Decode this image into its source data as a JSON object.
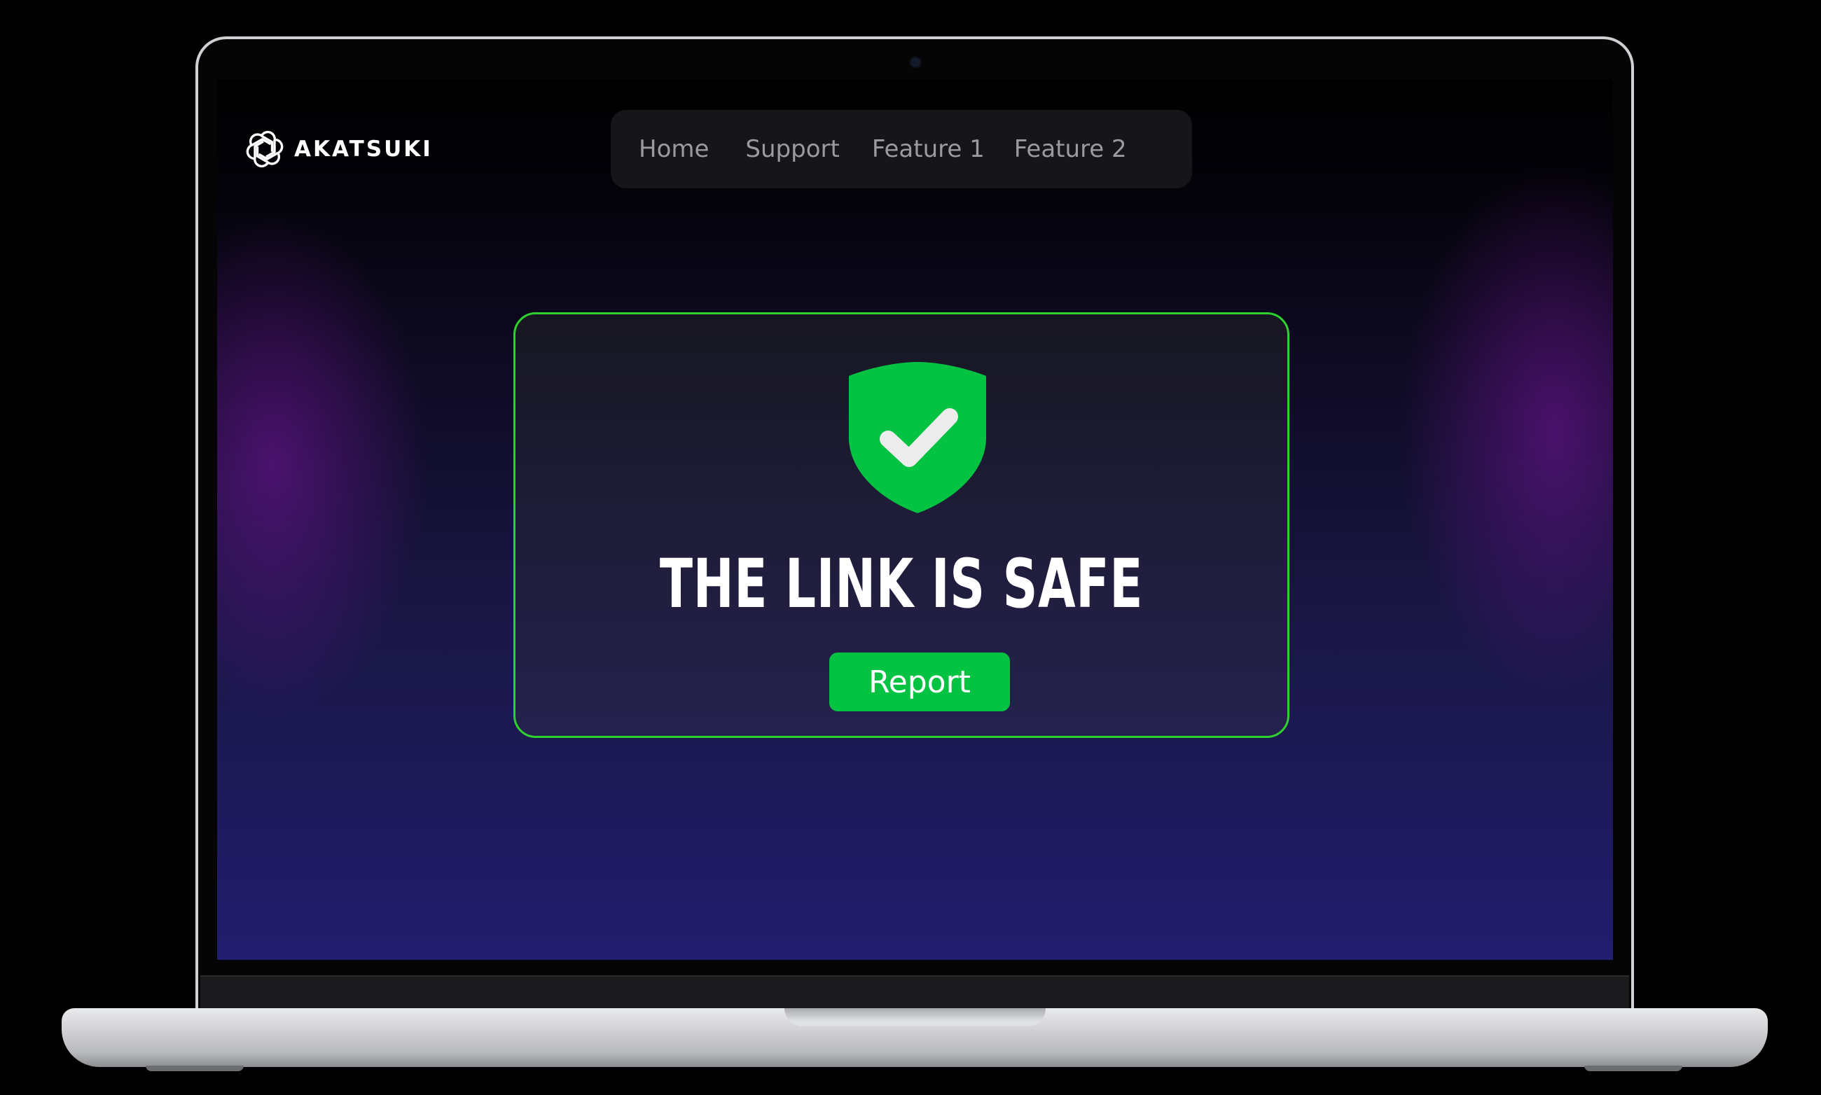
{
  "brand": {
    "name": "AKATSUKI",
    "icon": "openai-knot-logo"
  },
  "nav": {
    "items": [
      {
        "label": "Home"
      },
      {
        "label": "Support"
      },
      {
        "label": "Feature 1"
      },
      {
        "label": "Feature 2"
      }
    ]
  },
  "result": {
    "icon": "shield-check-icon",
    "headline": "THE LINK IS SAFE",
    "button_label": "Report"
  },
  "colors": {
    "accent_green": "#04c343",
    "card_border": "#2ed12e",
    "nav_bg": "#161618",
    "nav_text": "#9a9aa0",
    "background_bottom": "#221d6e"
  }
}
